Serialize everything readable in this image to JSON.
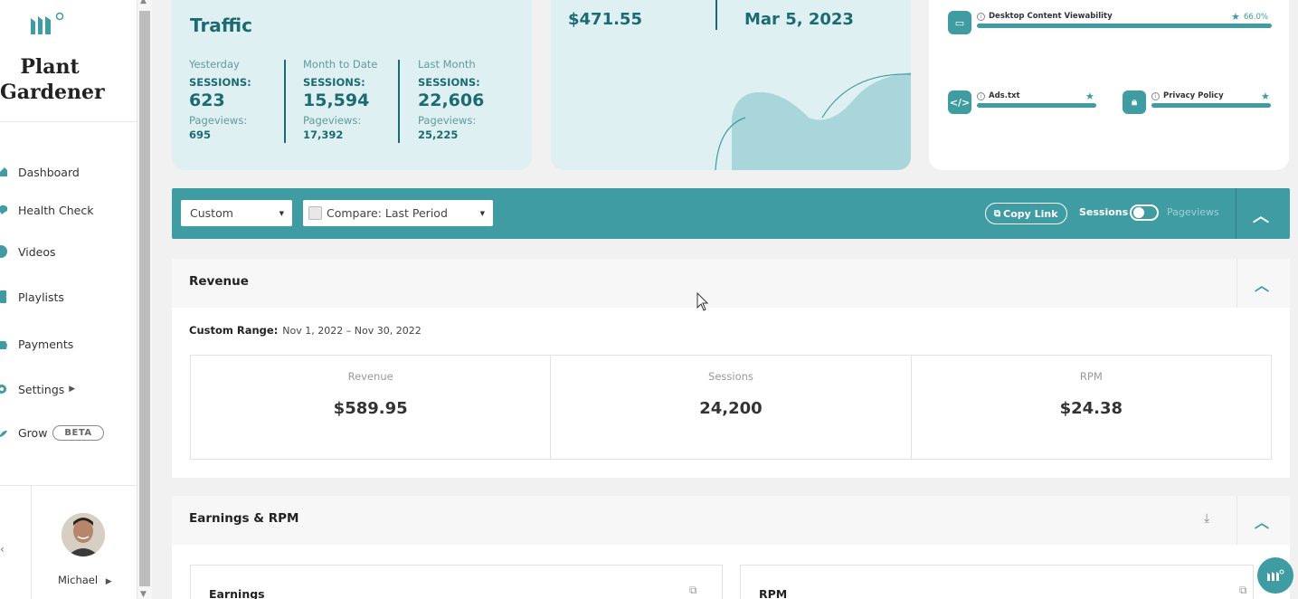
{
  "brand": {
    "name": "Plant Gardener"
  },
  "sidebar": {
    "items": [
      {
        "label": "Dashboard"
      },
      {
        "label": "Health Check"
      },
      {
        "label": "Videos"
      },
      {
        "label": "Playlists"
      },
      {
        "label": "Payments"
      },
      {
        "label": "Settings"
      },
      {
        "label": "Grow",
        "badge": "BETA"
      }
    ],
    "user": {
      "name": "Michael"
    }
  },
  "traffic": {
    "title": "Traffic",
    "columns": [
      {
        "period": "Yesterday",
        "sessions_label": "SESSIONS:",
        "sessions": "623",
        "pageviews_label": "Pageviews:",
        "pageviews": "695"
      },
      {
        "period": "Month to Date",
        "sessions_label": "SESSIONS:",
        "sessions": "15,594",
        "pageviews_label": "Pageviews:",
        "pageviews": "17,392"
      },
      {
        "period": "Last Month",
        "sessions_label": "SESSIONS:",
        "sessions": "22,606",
        "pageviews_label": "Pageviews:",
        "pageviews": "25,225"
      }
    ]
  },
  "earnings_card": {
    "amount": "$471.55",
    "date": "Mar 5, 2023"
  },
  "health": {
    "items": [
      {
        "icon": "monitor-icon",
        "label": "Desktop Content Viewability",
        "pct": "66.0%"
      },
      {
        "icon": "code-icon",
        "label": "Ads.txt"
      },
      {
        "icon": "lock-icon",
        "label": "Privacy Policy"
      }
    ]
  },
  "toolbar": {
    "range_select": "Custom",
    "compare_select": "Compare: Last Period",
    "copy_link": "Copy Link",
    "toggle_left": "Sessions",
    "toggle_right": "Pageviews"
  },
  "revenue": {
    "title": "Revenue",
    "range_label": "Custom Range:",
    "range_dates": "Nov 1, 2022 – Nov 30, 2022",
    "metrics": [
      {
        "label": "Revenue",
        "value": "$589.95"
      },
      {
        "label": "Sessions",
        "value": "24,200"
      },
      {
        "label": "RPM",
        "value": "$24.38"
      }
    ]
  },
  "earnings_rpm": {
    "title": "Earnings & RPM",
    "cards": [
      {
        "title": "Earnings"
      },
      {
        "title": "RPM"
      }
    ]
  },
  "colors": {
    "accent": "#3f9ca3",
    "card_bg": "#dff0f2",
    "dark_teal": "#1c6b73"
  }
}
